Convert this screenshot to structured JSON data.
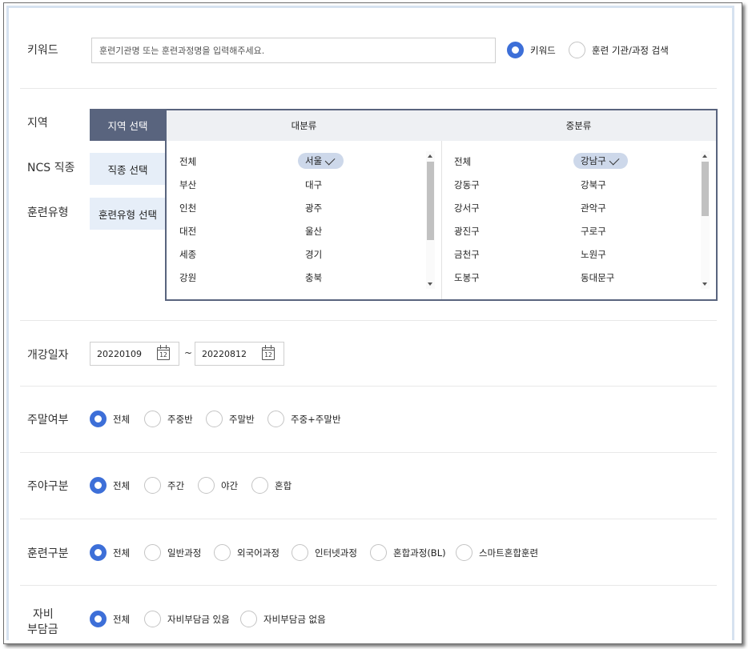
{
  "keyword": {
    "label": "키워드",
    "placeholder": "훈련기관명 또는 훈련과정명을 입력해주세요.",
    "options": [
      {
        "label": "키워드",
        "selected": true
      },
      {
        "label": "훈련 기관/과정 검색",
        "selected": false
      }
    ]
  },
  "filters": {
    "region_label": "지역",
    "ncs_label": "NCS 직종",
    "type_label": "훈련유형",
    "tabs": [
      {
        "label": "지역 선택",
        "active": true
      },
      {
        "label": "직종 선택",
        "active": false
      },
      {
        "label": "훈련유형 선택",
        "active": false
      }
    ]
  },
  "region_panel": {
    "major_header": "대분류",
    "minor_header": "중분류",
    "major": [
      [
        "전체",
        "서울"
      ],
      [
        "부산",
        "대구"
      ],
      [
        "인천",
        "광주"
      ],
      [
        "대전",
        "울산"
      ],
      [
        "세종",
        "경기"
      ],
      [
        "강원",
        "충북"
      ]
    ],
    "major_selected": "서울",
    "minor": [
      [
        "전체",
        "강남구"
      ],
      [
        "강동구",
        "강북구"
      ],
      [
        "강서구",
        "관악구"
      ],
      [
        "광진구",
        "구로구"
      ],
      [
        "금천구",
        "노원구"
      ],
      [
        "도봉구",
        "동대문구"
      ]
    ],
    "minor_selected": "강남구"
  },
  "open_date": {
    "label": "개강일자",
    "start": "20220109",
    "end": "20220812",
    "separator": "~",
    "calendar_icon_text": "12"
  },
  "weekend": {
    "label": "주말여부",
    "options": [
      {
        "label": "전체",
        "selected": true
      },
      {
        "label": "주중반",
        "selected": false
      },
      {
        "label": "주말반",
        "selected": false
      },
      {
        "label": "주중+주말반",
        "selected": false
      }
    ]
  },
  "daynight": {
    "label": "주야구분",
    "options": [
      {
        "label": "전체",
        "selected": true
      },
      {
        "label": "주간",
        "selected": false
      },
      {
        "label": "야간",
        "selected": false
      },
      {
        "label": "혼합",
        "selected": false
      }
    ]
  },
  "training_type": {
    "label": "훈련구분",
    "options": [
      {
        "label": "전체",
        "selected": true
      },
      {
        "label": "일반과정",
        "selected": false
      },
      {
        "label": "외국어과정",
        "selected": false
      },
      {
        "label": "인터넷과정",
        "selected": false
      },
      {
        "label": "혼합과정(BL)",
        "selected": false
      },
      {
        "label": "스마트혼합훈련",
        "selected": false
      }
    ]
  },
  "self_pay": {
    "label_line1": "자비",
    "label_line2": "부담금",
    "options": [
      {
        "label": "전체",
        "selected": true
      },
      {
        "label": "자비부담금 있음",
        "selected": false
      },
      {
        "label": "자비부담금 없음",
        "selected": false
      }
    ]
  },
  "colors": {
    "accent": "#3d6fd8",
    "tab_active": "#59647e",
    "tab_inactive": "#e6eef8",
    "chip": "#cdd8ea"
  }
}
